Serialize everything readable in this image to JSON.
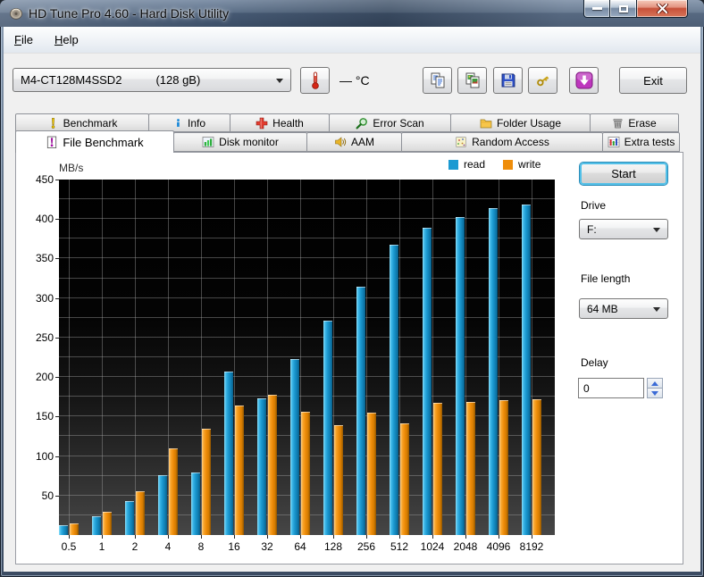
{
  "window": {
    "title": "HD Tune Pro 4.60 - Hard Disk Utility",
    "controls": [
      "minimize",
      "maximize",
      "close"
    ]
  },
  "menu": {
    "items": [
      {
        "accel": "F",
        "rest": "ile"
      },
      {
        "accel": "H",
        "rest": "elp"
      }
    ]
  },
  "toolbar": {
    "drive_selector": {
      "model": "M4-CT128M4SSD2",
      "capacity": "(128 gB)"
    },
    "temperature_display": "— °C",
    "icon_buttons": [
      "thermometer",
      "copy-text",
      "copy-image",
      "save",
      "options-key",
      "check-updates"
    ],
    "exit_label": "Exit"
  },
  "tabs": {
    "row1": [
      {
        "label": "Benchmark",
        "icon": "exclamation-icon"
      },
      {
        "label": "Info",
        "icon": "info-icon"
      },
      {
        "label": "Health",
        "icon": "health-cross-icon"
      },
      {
        "label": "Error Scan",
        "icon": "magnifier-icon"
      },
      {
        "label": "Folder Usage",
        "icon": "folder-icon"
      },
      {
        "label": "Erase",
        "icon": "trash-icon"
      }
    ],
    "row2": [
      {
        "label": "File Benchmark",
        "icon": "file-exclamation-icon",
        "active": true
      },
      {
        "label": "Disk monitor",
        "icon": "bar-chart-icon"
      },
      {
        "label": "AAM",
        "icon": "speaker-icon"
      },
      {
        "label": "Random Access",
        "icon": "scatter-icon"
      },
      {
        "label": "Extra tests",
        "icon": "extra-tests-icon"
      }
    ]
  },
  "panel": {
    "start_button": "Start",
    "drive_label": "Drive",
    "drive_value": "F:",
    "file_length_label": "File length",
    "file_length_value": "64 MB",
    "delay_label": "Delay",
    "delay_value": "0"
  },
  "chart_data": {
    "type": "bar",
    "ylabel": "MB/s",
    "ylim": [
      0,
      450
    ],
    "y_ticks": [
      450,
      400,
      350,
      300,
      250,
      200,
      150,
      100,
      50
    ],
    "grid_step": 25,
    "grid": true,
    "legend_position": "top-right",
    "plot_background": "#000000",
    "categories": [
      "0.5",
      "1",
      "2",
      "4",
      "8",
      "16",
      "32",
      "64",
      "128",
      "256",
      "512",
      "1024",
      "2048",
      "4096",
      "8192"
    ],
    "series": [
      {
        "name": "read",
        "color": "#1b9ad2",
        "values": [
          12,
          24,
          43,
          76,
          79,
          207,
          173,
          223,
          271,
          314,
          368,
          389,
          402,
          414,
          418
        ]
      },
      {
        "name": "write",
        "color": "#ef8d0a",
        "values": [
          15,
          29,
          55,
          110,
          134,
          164,
          177,
          156,
          139,
          155,
          141,
          167,
          169,
          171,
          172
        ]
      }
    ]
  }
}
